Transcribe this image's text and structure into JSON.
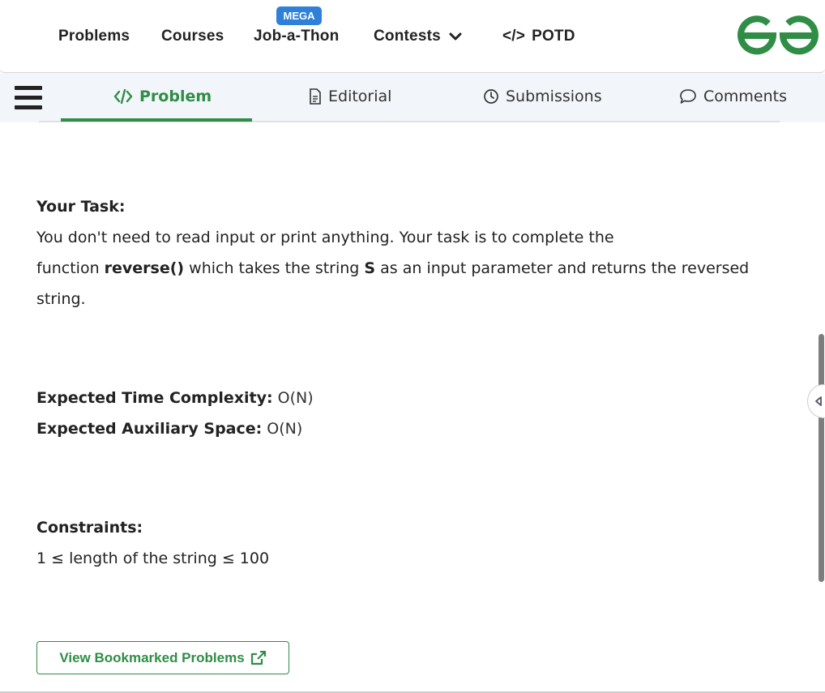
{
  "nav": {
    "items": [
      {
        "label": "Problems"
      },
      {
        "label": "Courses"
      },
      {
        "label": "Job-a-Thon"
      },
      {
        "label": "Contests"
      },
      {
        "label": "POTD"
      }
    ],
    "mega_badge": "MEGA",
    "potd_icon": "</>",
    "logo": "gfg-logo",
    "logo_color": "#2f8d46"
  },
  "tabs": {
    "items": [
      {
        "label": "Problem",
        "icon": "code-icon",
        "active": true
      },
      {
        "label": "Editorial",
        "icon": "document-icon"
      },
      {
        "label": "Submissions",
        "icon": "clock-icon"
      },
      {
        "label": "Comments",
        "icon": "chat-bubble-icon"
      }
    ],
    "accent": "#2f8d46"
  },
  "content": {
    "task_heading": "Your Task:",
    "task_line1": "You don't need to read input or print anything. Your task is to complete the",
    "task_line2_a": "function ",
    "task_line2_fn": "reverse()",
    "task_line2_b": " which takes the string ",
    "task_line2_s": "S",
    "task_line2_c": " as an input parameter and returns the reversed",
    "task_line3": "string.",
    "time_label": "Expected Time Complexity:",
    "time_value": " O(N)",
    "space_label": "Expected Auxiliary Space:",
    "space_value": " O(N)",
    "constraints_heading": "Constraints:",
    "constraint_1": "1 ≤ length of the string ≤ 100"
  },
  "bookmark_button": "View Bookmarked Problems"
}
